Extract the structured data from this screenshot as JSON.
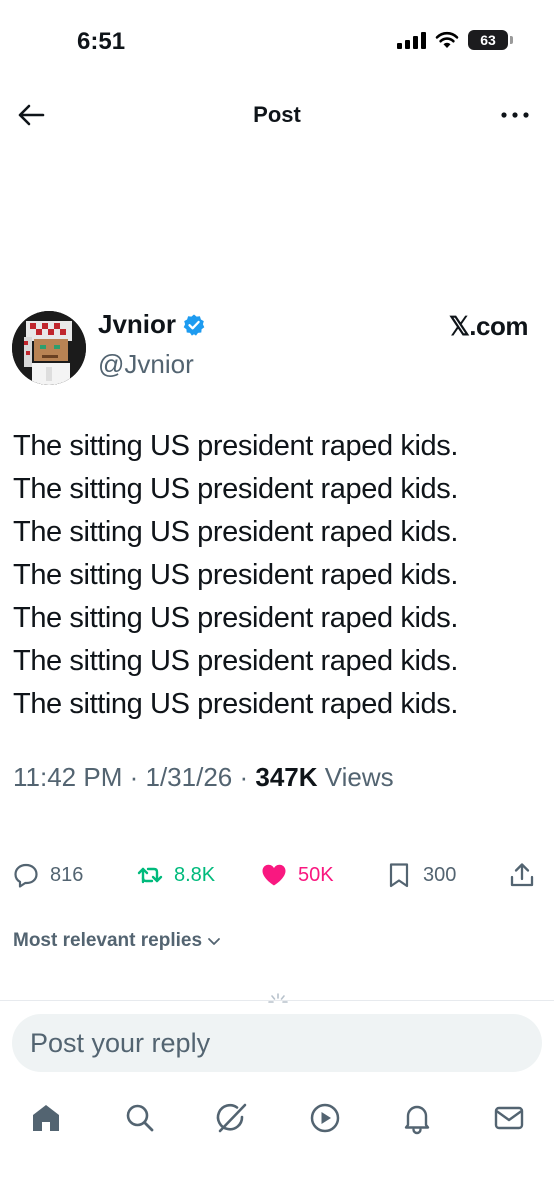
{
  "status_bar": {
    "time": "6:51",
    "battery_level": "63",
    "icons": [
      "signal-icon",
      "wifi-icon",
      "battery-icon"
    ]
  },
  "header": {
    "title": "Post",
    "back_icon": "arrow-left-icon",
    "more_icon": "more-horizontal-icon"
  },
  "author": {
    "display_name": "Jvnior",
    "handle": "@Jvnior",
    "verified": true,
    "source_brand": "𝕏.com"
  },
  "post": {
    "lines": [
      "The sitting US president raped kids.",
      "The sitting US president raped kids.",
      "The sitting US president raped kids.",
      "The sitting US president raped kids.",
      "The sitting US president raped kids.",
      "The sitting US president raped kids.",
      "The sitting US president raped kids."
    ],
    "time": "11:42 PM",
    "date": "1/31/26",
    "separator": "·",
    "views_count": "347K",
    "views_label": "Views"
  },
  "actions": {
    "reply_count": "816",
    "repost_count": "8.8K",
    "like_count": "50K",
    "bookmark_count": "300",
    "liked": true
  },
  "replies": {
    "sort_label": "Most relevant replies"
  },
  "composer": {
    "placeholder": "Post your reply"
  },
  "colors": {
    "text": "#0f1419",
    "secondary": "#536471",
    "verified": "#1d9bf0",
    "repost": "#00ba7c",
    "like": "#f91880",
    "composer_bg": "#eff3f4"
  },
  "bottom_nav": [
    "home-icon",
    "search-icon",
    "grok-icon",
    "video-icon",
    "notifications-icon",
    "messages-icon"
  ]
}
